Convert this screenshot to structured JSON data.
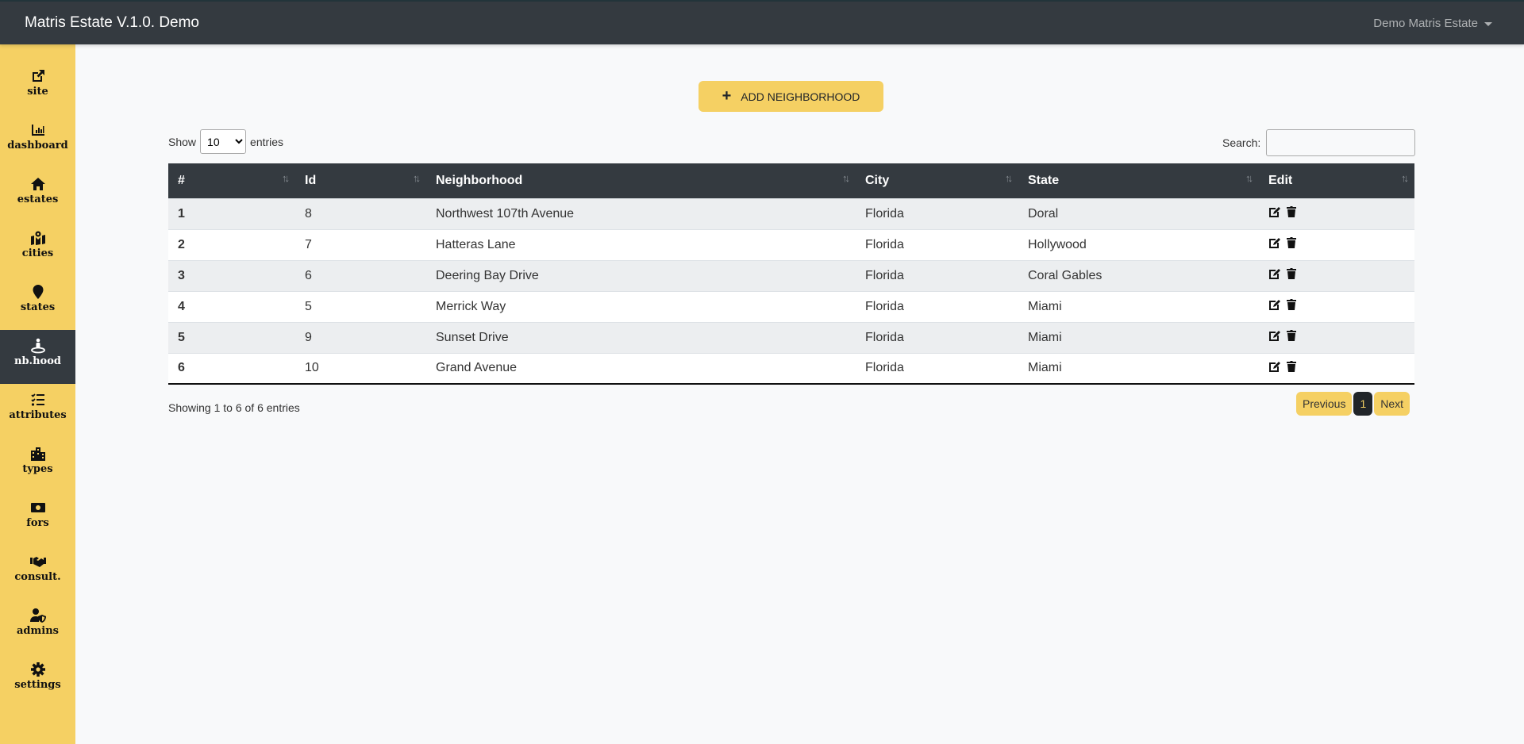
{
  "app": {
    "title": "Matris Estate V.1.0. Demo",
    "user": "Demo Matris Estate"
  },
  "sidebar": {
    "items": [
      {
        "label": "site",
        "icon": "external-link-icon"
      },
      {
        "label": "dashboard",
        "icon": "chart-bar-icon"
      },
      {
        "label": "estates",
        "icon": "home-icon"
      },
      {
        "label": "cities",
        "icon": "map-marked-icon"
      },
      {
        "label": "states",
        "icon": "map-marker-icon"
      },
      {
        "label": "nb.hood",
        "icon": "street-view-icon",
        "active": true
      },
      {
        "label": "attributes",
        "icon": "tasks-icon"
      },
      {
        "label": "types",
        "icon": "city-icon"
      },
      {
        "label": "fors",
        "icon": "money-bill-icon"
      },
      {
        "label": "consult.",
        "icon": "handshake-icon"
      },
      {
        "label": "admins",
        "icon": "user-shield-icon"
      },
      {
        "label": "settings",
        "icon": "gear-icon"
      }
    ]
  },
  "toolbar": {
    "add_label": "ADD NEIGHBORHOOD"
  },
  "table": {
    "show_label": "Show",
    "entries_label": "entries",
    "page_size": "10",
    "search_label": "Search:",
    "search_value": "",
    "columns": [
      "#",
      "Id",
      "Neighborhood",
      "City",
      "State",
      "Edit"
    ],
    "rows": [
      [
        "1",
        "8",
        "Northwest 107th Avenue",
        "Florida",
        "Doral"
      ],
      [
        "2",
        "7",
        "Hatteras Lane",
        "Florida",
        "Hollywood"
      ],
      [
        "3",
        "6",
        "Deering Bay Drive",
        "Florida",
        "Coral Gables"
      ],
      [
        "4",
        "5",
        "Merrick Way",
        "Florida",
        "Miami"
      ],
      [
        "5",
        "9",
        "Sunset Drive",
        "Florida",
        "Miami"
      ],
      [
        "6",
        "10",
        "Grand Avenue",
        "Florida",
        "Miami"
      ]
    ],
    "info": "Showing 1 to 6 of 6 entries",
    "pagination": {
      "previous": "Previous",
      "current": "1",
      "next": "Next"
    }
  },
  "colors": {
    "accent": "#f5d063",
    "dark": "#343a40"
  }
}
